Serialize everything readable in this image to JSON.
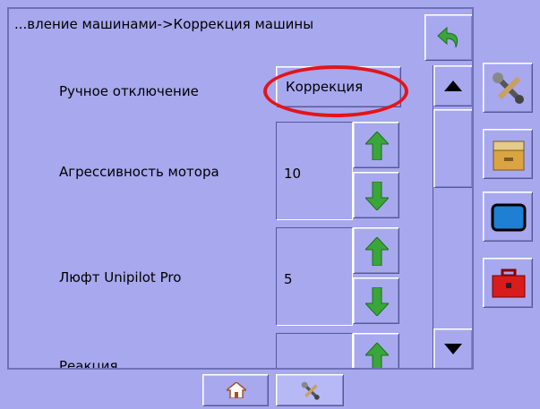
{
  "breadcrumb": "...вление машинами->Коррекция машины",
  "settings": [
    {
      "label": "Ручное отключение",
      "value": "Коррекция"
    },
    {
      "label": "Агрессивность мотора",
      "value": "10"
    },
    {
      "label": "Люфт Unipilot Pro",
      "value": "5"
    },
    {
      "label": "Реакция",
      "value": ""
    }
  ],
  "icons": {
    "back": "back-arrow-icon",
    "scroll_up": "triangle-up-icon",
    "scroll_down": "triangle-down-icon",
    "increase": "green-up-arrow-icon",
    "decrease": "green-down-arrow-icon",
    "tools": "tools-icon",
    "archive": "filing-drawer-icon",
    "display": "monitor-icon",
    "toolbox": "red-toolbox-icon",
    "home": "home-icon"
  },
  "colors": {
    "background": "#a7a8ee",
    "highlight": "#e3141b",
    "arrow": "#3aa63a"
  }
}
